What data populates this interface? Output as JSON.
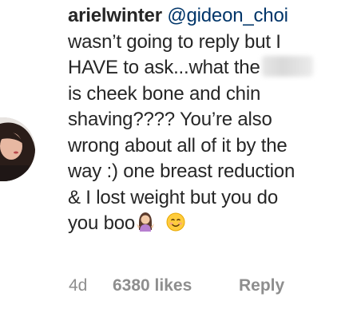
{
  "comment": {
    "username": "arielwinter",
    "mention": "@gideon_choi",
    "lines": [
      "wasn’t going to reply but I",
      "HAVE to ask...what the",
      "is cheek bone and chin",
      "shaving???? You’re also",
      "wrong about all of it by the",
      "way :) one breast reduction",
      "& I lost weight but you do",
      "you boo"
    ],
    "emojis": [
      "shrugging-woman-emoji",
      "smiling-face-emoji"
    ]
  },
  "meta": {
    "time": "4d",
    "likes": "6380 likes",
    "reply": "Reply"
  },
  "colors": {
    "text": "#262626",
    "meta": "#8e8e8e",
    "mention": "#003569"
  }
}
